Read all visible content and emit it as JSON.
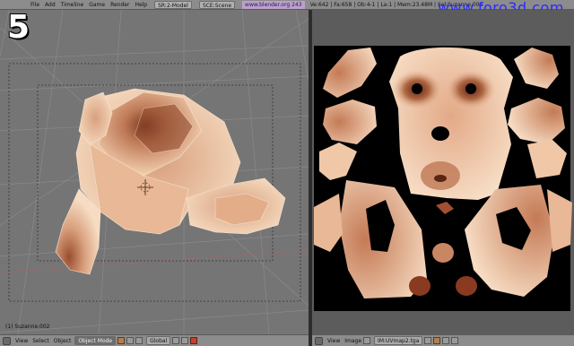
{
  "top_menu": {
    "items": [
      "File",
      "Add",
      "Timeline",
      "Game",
      "Render",
      "Help"
    ],
    "screen_field": "SR:2-Model",
    "scene_field": "SCE:Scene",
    "url": "www.blender.org 243",
    "stats": "Ve:642 | Fa:658 | Ob:4-1 | La:1 | Mem:23.48M | Sel:Suzanne.002",
    "watermark": "www.foro3d.com"
  },
  "step_number": "5",
  "viewport": {
    "object_label": "(1) Suzanne.002"
  },
  "viewport_header": {
    "view": "View",
    "select": "Select",
    "object": "Object",
    "mode": "Object Mode",
    "pivot": "Global"
  },
  "image_header": {
    "view": "View",
    "image": "Image",
    "image_name": "IM:UVmap2.tga"
  },
  "colors": {
    "skin_light": "#f3d2b2",
    "skin_mid": "#d49270",
    "skin_dark": "#7a3a20",
    "uv_background": "#000000",
    "viewport_bg": "#757575"
  },
  "icons": {
    "cursor": "3d-cursor-icon",
    "editor_type": "editor-type-icon"
  }
}
